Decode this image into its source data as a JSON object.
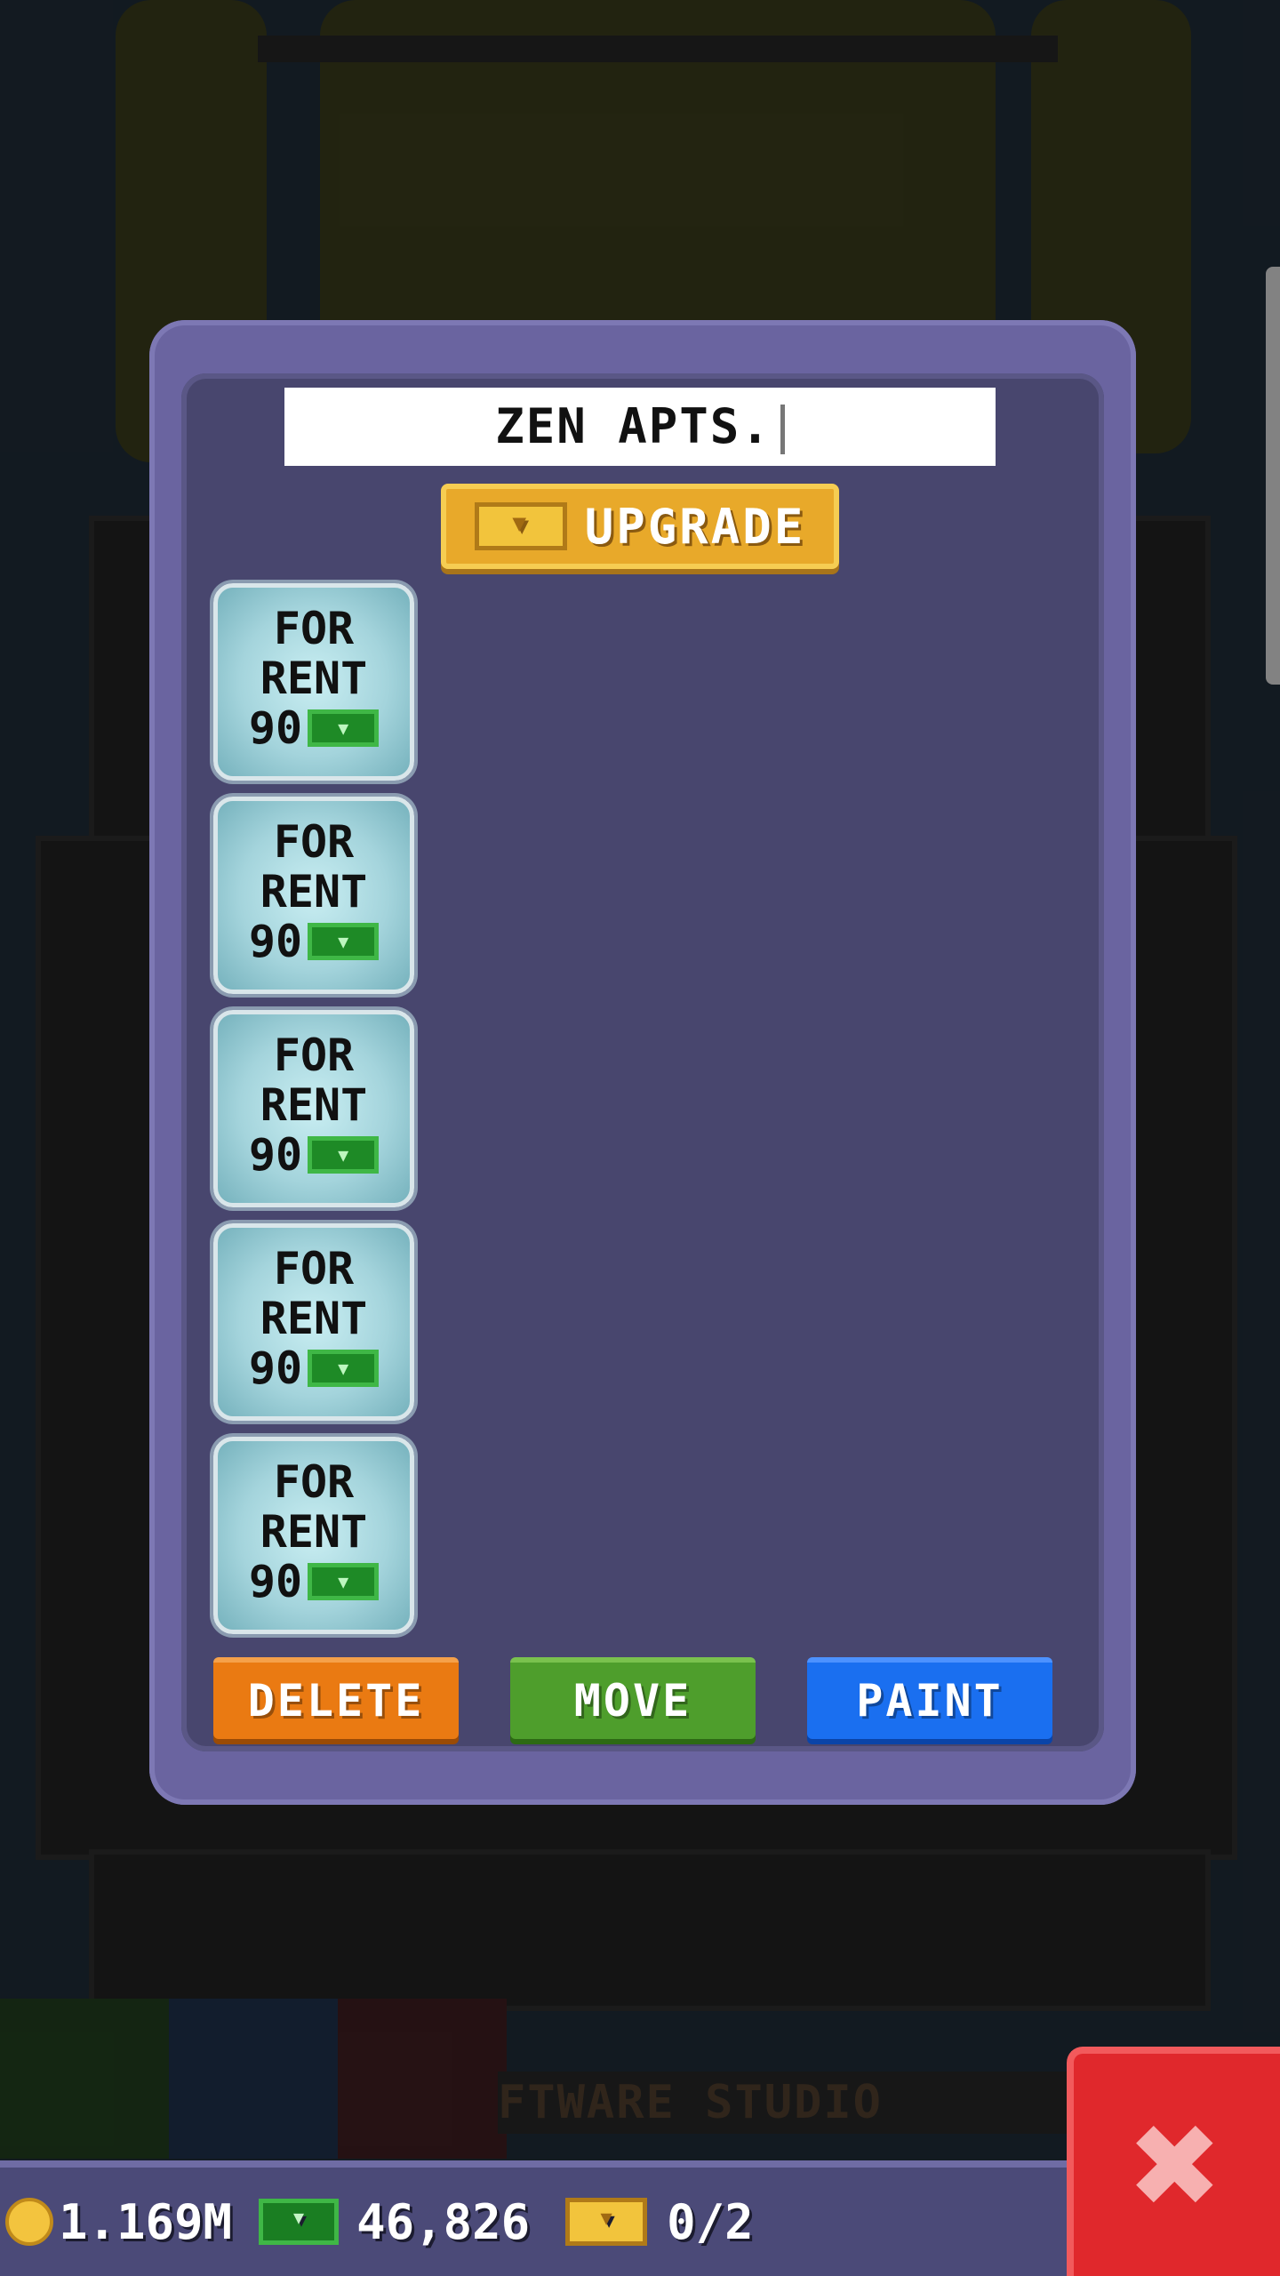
{
  "dialog": {
    "floor_name": "ZEN APTS.",
    "upgrade_label": "UPGRADE",
    "rooms": [
      {
        "line1": "FOR",
        "line2": "RENT",
        "price": "90"
      },
      {
        "line1": "FOR",
        "line2": "RENT",
        "price": "90"
      },
      {
        "line1": "FOR",
        "line2": "RENT",
        "price": "90"
      },
      {
        "line1": "FOR",
        "line2": "RENT",
        "price": "90"
      },
      {
        "line1": "FOR",
        "line2": "RENT",
        "price": "90"
      }
    ],
    "actions": {
      "delete": "DELETE",
      "move": "MOVE",
      "paint": "PAINT"
    }
  },
  "background": {
    "studio_sign": "FTWARE STUDIO"
  },
  "status_bar": {
    "coins": "1.169M",
    "bux": "46,826",
    "tickets": "0/2"
  },
  "icons": {
    "upgrade": "golden-ticket-icon",
    "rent": "tower-bux-icon",
    "coins": "coin-icon",
    "close": "close-x-icon"
  },
  "colors": {
    "dialog_border": "#6a64a0",
    "dialog_fill": "#48466e",
    "delete": "#ea7a12",
    "move": "#4e9e2c",
    "paint": "#1a6ff0",
    "close": "#e0282c",
    "upgrade": "#e8a92a"
  }
}
